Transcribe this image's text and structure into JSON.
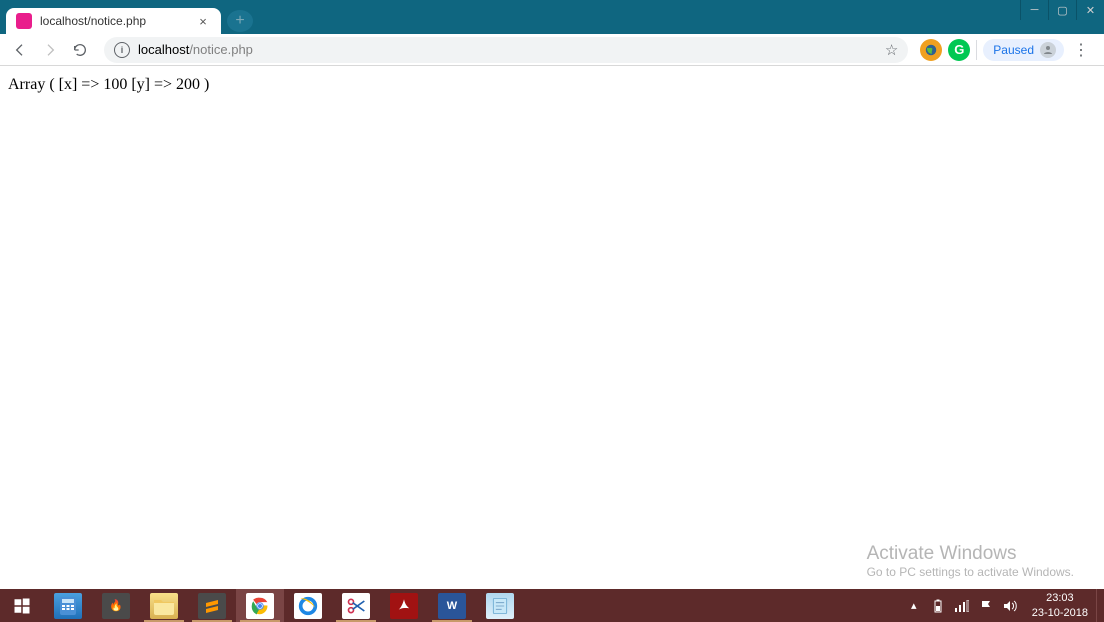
{
  "browser": {
    "tab_title": "localhost/notice.php",
    "url_host": "localhost",
    "url_path": "/notice.php",
    "paused_label": "Paused"
  },
  "page": {
    "body_text": "Array ( [x] => 100 [y] => 200 )"
  },
  "watermark": {
    "title": "Activate Windows",
    "subtitle": "Go to PC settings to activate Windows."
  },
  "taskbar": {
    "time": "23:03",
    "date": "23-10-2018"
  }
}
